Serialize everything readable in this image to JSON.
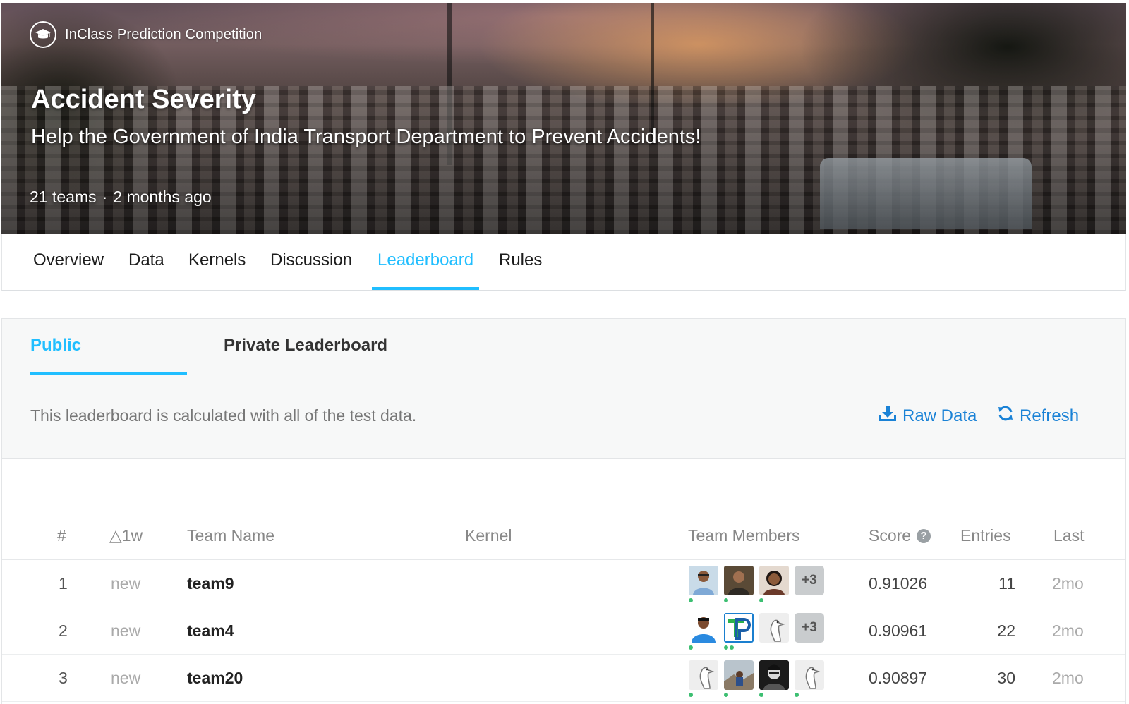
{
  "header": {
    "competition_type": "InClass Prediction Competition",
    "title": "Accident Severity",
    "subtitle": "Help the Government of India Transport Department to Prevent Accidents!",
    "teams": "21 teams",
    "separator": "·",
    "age": "2 months ago"
  },
  "nav": {
    "tabs": [
      "Overview",
      "Data",
      "Kernels",
      "Discussion",
      "Leaderboard",
      "Rules"
    ],
    "active": "Leaderboard"
  },
  "leaderboard": {
    "tabs": [
      "Public Leaderboard",
      "Private Leaderboard"
    ],
    "active_tab": "Public Leaderboard",
    "info_text": "This leaderboard is calculated with all of the test data.",
    "raw_data_label": "Raw Data",
    "refresh_label": "Refresh",
    "columns": {
      "rank": "#",
      "delta": "△1w",
      "team_name": "Team Name",
      "kernel": "Kernel",
      "team_members": "Team Members",
      "score": "Score",
      "entries": "Entries",
      "last": "Last"
    },
    "rows": [
      {
        "rank": "1",
        "delta": "new",
        "team": "team9",
        "more": "+3",
        "score": "0.91026",
        "entries": "11",
        "last": "2mo"
      },
      {
        "rank": "2",
        "delta": "new",
        "team": "team4",
        "more": "+3",
        "score": "0.90961",
        "entries": "22",
        "last": "2mo"
      },
      {
        "rank": "3",
        "delta": "new",
        "team": "team20",
        "more": "",
        "score": "0.90897",
        "entries": "30",
        "last": "2mo"
      }
    ]
  },
  "colors": {
    "accent": "#20beff",
    "link": "#1a82d6",
    "online_dot": "#3dbf72"
  }
}
